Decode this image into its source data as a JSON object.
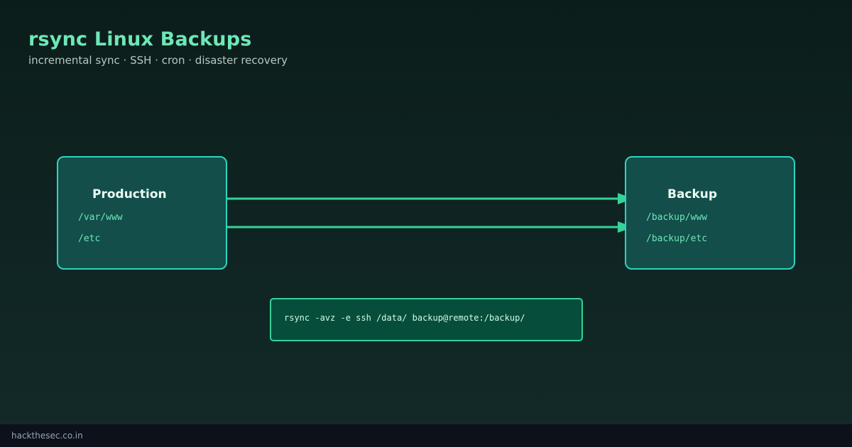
{
  "header": {
    "title": "rsync Linux Backups",
    "subtitle": "incremental sync · SSH · cron · disaster recovery"
  },
  "diagram": {
    "source": {
      "title": "Production",
      "paths": [
        "/var/www",
        "/etc"
      ]
    },
    "target": {
      "title": "Backup",
      "paths": [
        "/backup/www",
        "/backup/etc"
      ]
    },
    "arrow_color": "#34d399"
  },
  "command": {
    "text": "rsync -avz -e ssh /data/ backup@remote:/backup/"
  },
  "footer": {
    "site": "hackthesec.co.in"
  },
  "colors": {
    "accent": "#6ee7b7",
    "box_fill": "#134e4a",
    "box_border": "#2dd4bf",
    "command_fill": "#064e3b",
    "footer_bg": "#0c111a"
  }
}
